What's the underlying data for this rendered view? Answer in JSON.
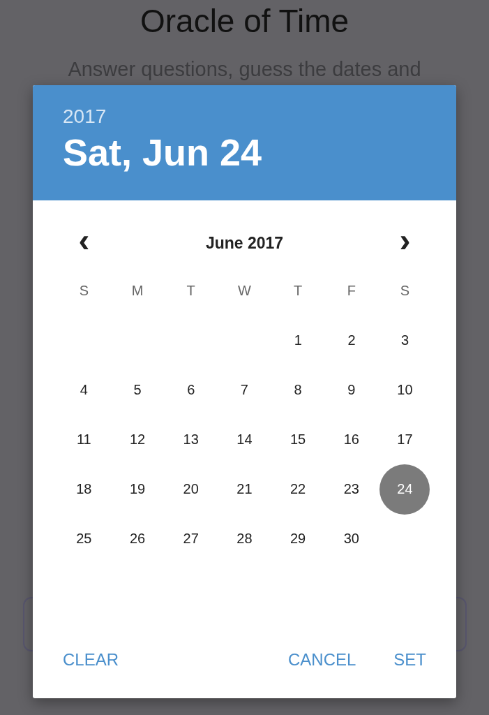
{
  "page": {
    "title": "Oracle of Time",
    "subtitle": "Answer questions, guess the dates and"
  },
  "dialog": {
    "year": "2017",
    "date": "Sat, Jun 24",
    "month": "June 2017",
    "prev": "‹",
    "next": "›",
    "weekdays": [
      "S",
      "M",
      "T",
      "W",
      "T",
      "F",
      "S"
    ],
    "weeks": [
      {
        "kind": "trailing",
        "days": [
          {
            "label": "1",
            "selected": false
          },
          {
            "label": "2",
            "selected": false
          },
          {
            "label": "3",
            "selected": false
          }
        ]
      },
      {
        "kind": "full",
        "days": [
          {
            "label": "4",
            "selected": false
          },
          {
            "label": "5",
            "selected": false
          },
          {
            "label": "6",
            "selected": false
          },
          {
            "label": "7",
            "selected": false
          },
          {
            "label": "8",
            "selected": false
          },
          {
            "label": "9",
            "selected": false
          },
          {
            "label": "10",
            "selected": false
          }
        ]
      },
      {
        "kind": "full",
        "days": [
          {
            "label": "11",
            "selected": false
          },
          {
            "label": "12",
            "selected": false
          },
          {
            "label": "13",
            "selected": false
          },
          {
            "label": "14",
            "selected": false
          },
          {
            "label": "15",
            "selected": false
          },
          {
            "label": "16",
            "selected": false
          },
          {
            "label": "17",
            "selected": false
          }
        ]
      },
      {
        "kind": "full",
        "days": [
          {
            "label": "18",
            "selected": false
          },
          {
            "label": "19",
            "selected": false
          },
          {
            "label": "20",
            "selected": false
          },
          {
            "label": "21",
            "selected": false
          },
          {
            "label": "22",
            "selected": false
          },
          {
            "label": "23",
            "selected": false
          },
          {
            "label": "24",
            "selected": true
          }
        ]
      },
      {
        "kind": "full",
        "days": [
          {
            "label": "25",
            "selected": false
          },
          {
            "label": "26",
            "selected": false
          },
          {
            "label": "27",
            "selected": false
          },
          {
            "label": "28",
            "selected": false
          },
          {
            "label": "29",
            "selected": false
          },
          {
            "label": "30",
            "selected": false
          }
        ]
      }
    ],
    "buttons": {
      "left": [
        "CLEAR"
      ],
      "right": [
        "CANCEL",
        "SET"
      ]
    }
  }
}
